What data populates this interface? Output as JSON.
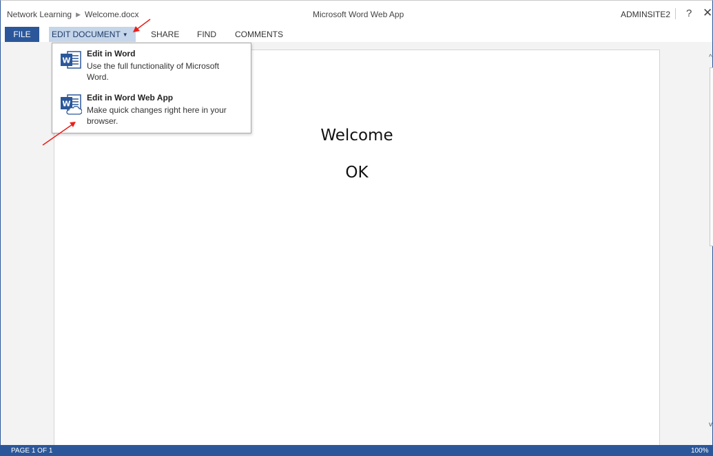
{
  "titlebar": {
    "breadcrumb_site": "Network Learning",
    "breadcrumb_file": "Welcome.docx",
    "app_title": "Microsoft Word Web App",
    "user": "ADMINSITE2",
    "help": "?",
    "close": "✕"
  },
  "ribbon": {
    "tabs": {
      "file": "FILE",
      "edit_document": "EDIT DOCUMENT",
      "share": "SHARE",
      "find": "FIND",
      "comments": "COMMENTS"
    },
    "active_tab": "EDIT DOCUMENT"
  },
  "dropdown": {
    "items": [
      {
        "title": "Edit in Word",
        "description": "Use the full functionality of Microsoft Word.",
        "icon": "word-icon"
      },
      {
        "title": "Edit in Word Web App",
        "description": "Make quick changes right here in your browser.",
        "icon": "word-web-app-icon"
      }
    ]
  },
  "document": {
    "lines": [
      "Welcome",
      "OK"
    ]
  },
  "statusbar": {
    "page": "PAGE 1 OF 1",
    "zoom": "100%"
  },
  "colors": {
    "accent": "#2b579a",
    "tab_highlight": "#c5d5ea",
    "annotation": "#e8201b"
  }
}
